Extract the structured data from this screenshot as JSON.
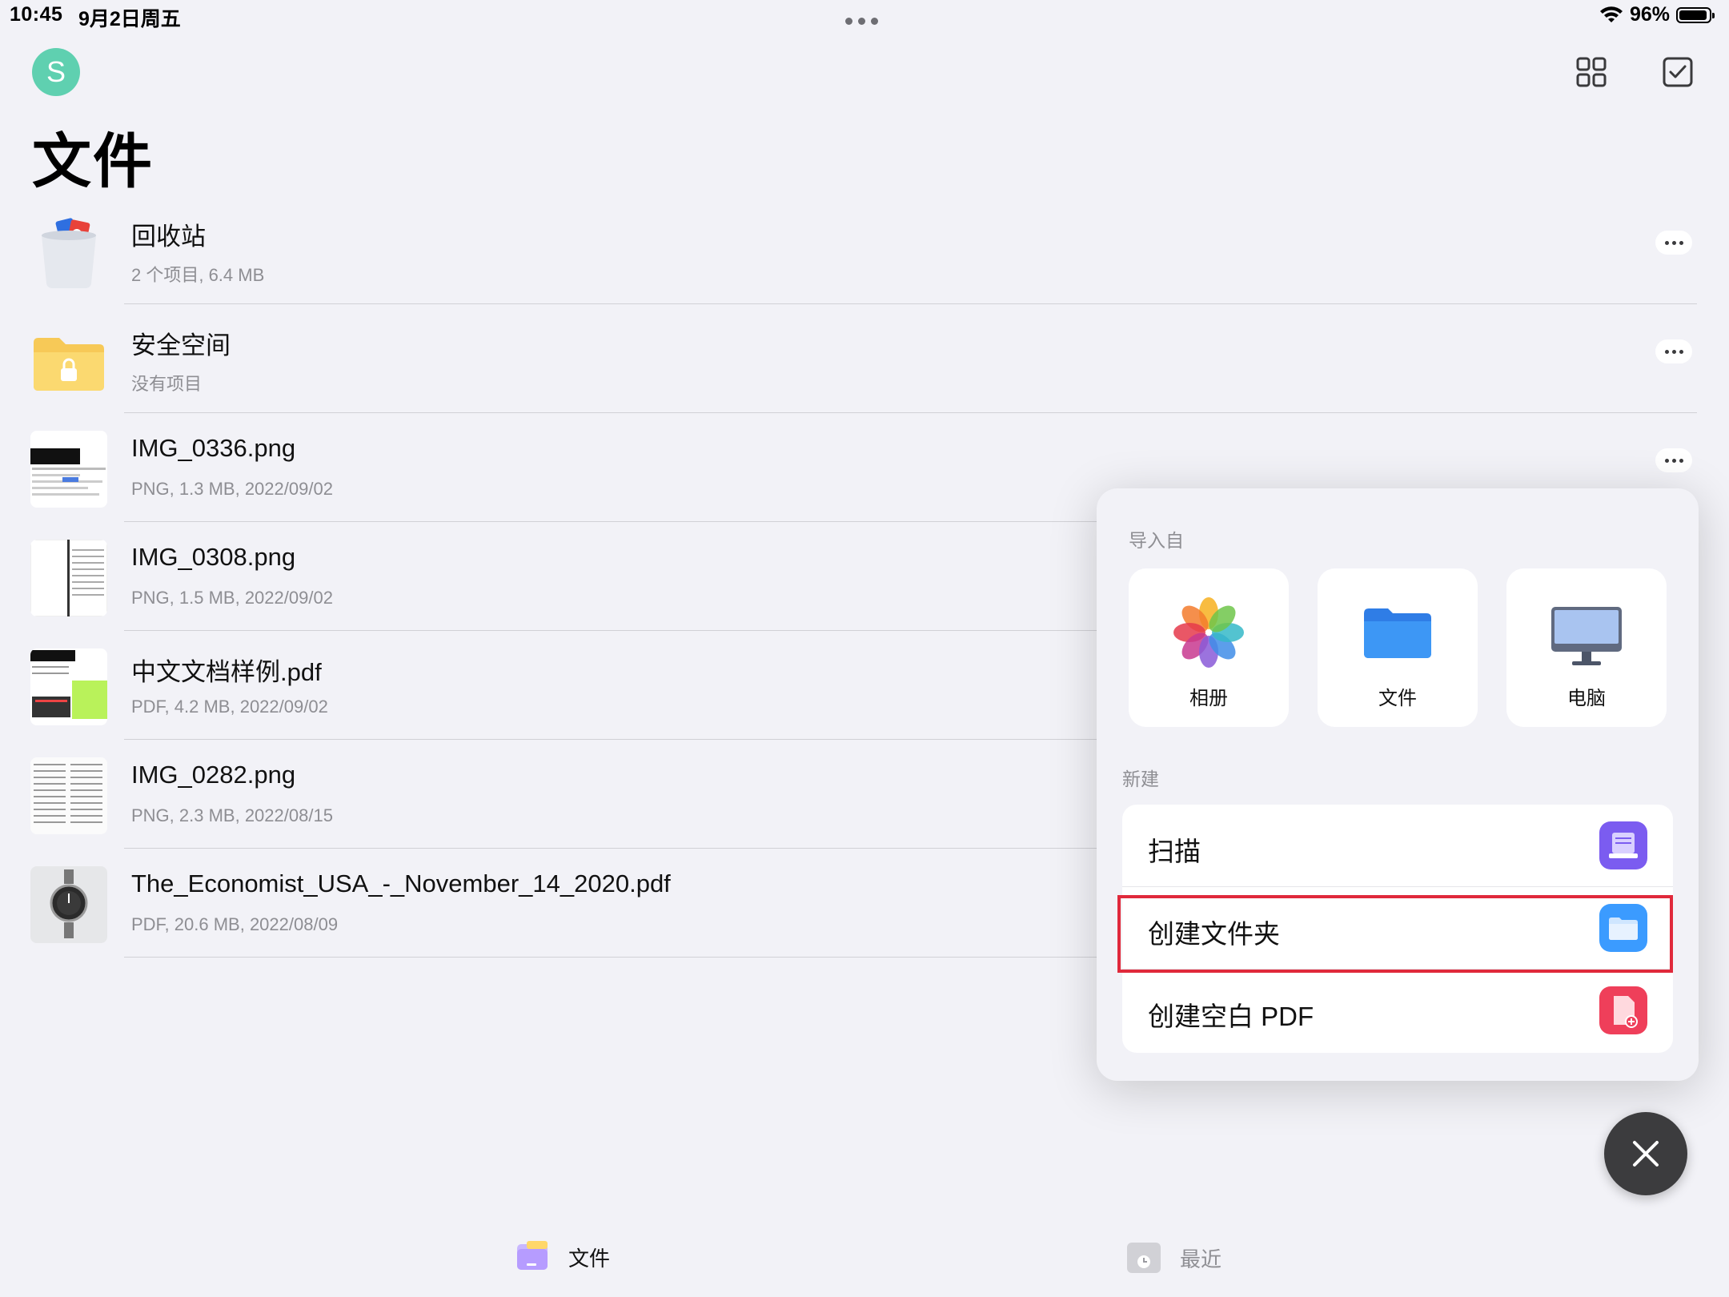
{
  "status": {
    "time": "10:45",
    "date": "9月2日周五",
    "battery": "96%"
  },
  "header": {
    "avatar_letter": "S",
    "title": "文件"
  },
  "files": [
    {
      "name": "回收站",
      "meta": "2 个项目, 6.4 MB",
      "thumb": "trash-icon"
    },
    {
      "name": "安全空间",
      "meta": "没有项目",
      "thumb": "secure-folder-icon"
    },
    {
      "name": "IMG_0336.png",
      "meta": "PNG, 1.3 MB, 2022/09/02",
      "thumb": "image-thumbnail"
    },
    {
      "name": "IMG_0308.png",
      "meta": "PNG, 1.5 MB, 2022/09/02",
      "thumb": "image-thumbnail"
    },
    {
      "name": "中文文档样例.pdf",
      "meta": "PDF, 4.2 MB, 2022/09/02",
      "thumb": "pdf-thumbnail"
    },
    {
      "name": "IMG_0282.png",
      "meta": "PNG, 2.3 MB, 2022/08/15",
      "thumb": "image-thumbnail"
    },
    {
      "name": "The_Economist_USA_-_November_14_2020.pdf",
      "meta": "PDF, 20.6 MB, 2022/08/09",
      "thumb": "pdf-thumbnail"
    }
  ],
  "popup": {
    "import_label": "导入自",
    "import_sources": [
      {
        "label": "相册",
        "icon": "photos-icon"
      },
      {
        "label": "文件",
        "icon": "files-folder-icon"
      },
      {
        "label": "电脑",
        "icon": "computer-icon"
      }
    ],
    "new_label": "新建",
    "new_items": [
      {
        "label": "扫描",
        "icon": "scan-icon",
        "color": "#7b5cf0"
      },
      {
        "label": "创建文件夹",
        "icon": "folder-icon",
        "color": "#3b9bff"
      },
      {
        "label": "创建空白 PDF",
        "icon": "pdf-icon",
        "color": "#ef3f5a"
      }
    ]
  },
  "tabbar": {
    "files": "文件",
    "recent": "最近"
  }
}
